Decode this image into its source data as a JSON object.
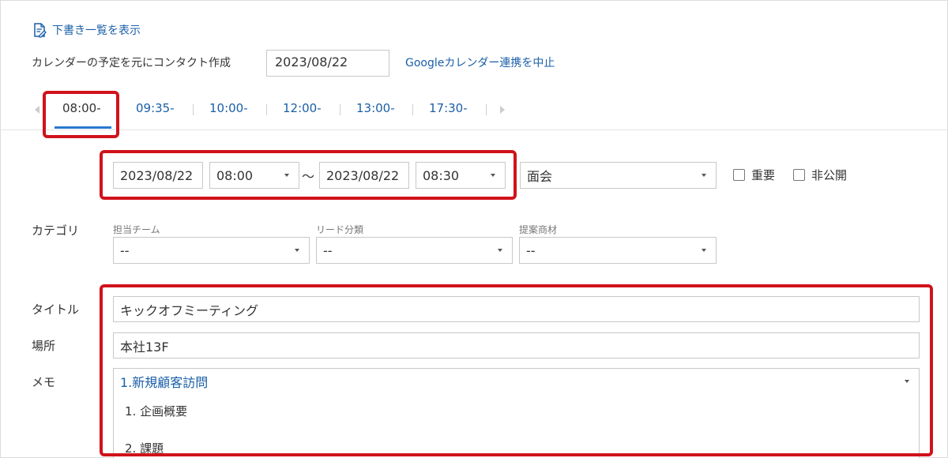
{
  "header": {
    "draft_list_link": "下書き一覧を表示",
    "calendar_label": "カレンダーの予定を元にコンタクト作成",
    "calendar_date": "2023/08/22",
    "stop_sync_link": "Googleカレンダー連携を中止"
  },
  "tabs": [
    {
      "label": "08:00-",
      "active": true
    },
    {
      "label": "09:35-",
      "active": false
    },
    {
      "label": "10:00-",
      "active": false
    },
    {
      "label": "12:00-",
      "active": false
    },
    {
      "label": "13:00-",
      "active": false
    },
    {
      "label": "17:30-",
      "active": false
    }
  ],
  "schedule": {
    "start_date": "2023/08/22",
    "start_time": "08:00",
    "separator": "～",
    "end_date": "2023/08/22",
    "end_time": "08:30",
    "type": "面会",
    "important_label": "重要",
    "important_checked": false,
    "private_label": "非公開",
    "private_checked": false
  },
  "category": {
    "label": "カテゴリ",
    "fields": [
      {
        "label": "担当チーム",
        "value": "--"
      },
      {
        "label": "リード分類",
        "value": "--"
      },
      {
        "label": "提案商材",
        "value": "--"
      }
    ]
  },
  "form": {
    "title_label": "タイトル",
    "title_value": "キックオフミーティング",
    "place_label": "場所",
    "place_value": "本社13F",
    "memo_label": "メモ",
    "memo_template": "1.新規顧客訪問",
    "memo_lines": [
      "1. 企画概要",
      "2. 課題"
    ]
  },
  "colors": {
    "link": "#1a5fa8",
    "highlight": "#d0121b",
    "tab_underline": "#2a78d4"
  }
}
